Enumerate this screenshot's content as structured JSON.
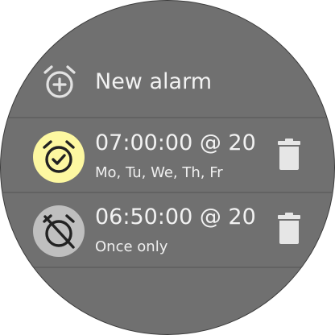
{
  "new_alarm": {
    "label": "New alarm",
    "icon": "add-alarm-icon"
  },
  "alarms": [
    {
      "time": "07:00:00 @ 20",
      "days": "Mo, Tu, We, Th, Fr",
      "enabled": true,
      "status_icon": "alarm-on-icon",
      "badge_color": "#fdf8a1",
      "delete_icon": "trash-icon"
    },
    {
      "time": "06:50:00 @ 20",
      "days": "Once only",
      "enabled": false,
      "status_icon": "alarm-off-icon",
      "badge_color": "#bfbfbf",
      "delete_icon": "trash-icon"
    }
  ],
  "colors": {
    "background": "#707070",
    "divider": "#626262",
    "text": "#f2f2f2",
    "icon": "#e6e6e6"
  }
}
